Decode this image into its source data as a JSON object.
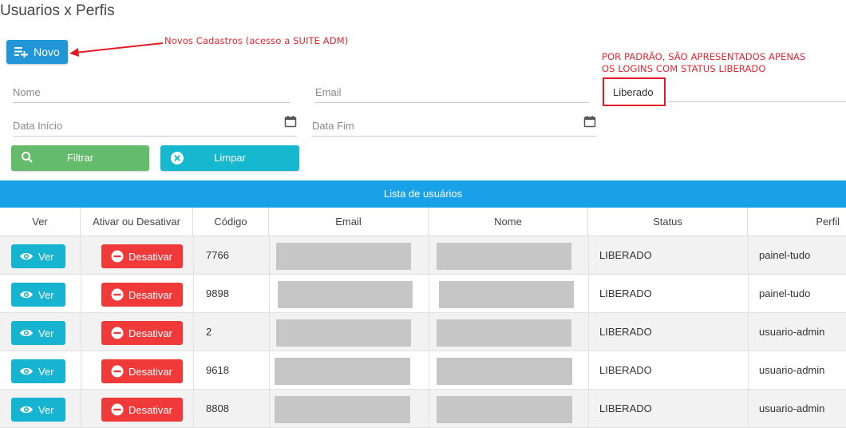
{
  "page": {
    "title": "Usuarios x Perfis"
  },
  "toolbar": {
    "novo_label": "Novo"
  },
  "annotations": {
    "novo_note": "Novos Cadastros (acesso a SUITE ADM)",
    "status_note_line1": "POR PADRÃO, SÃO APRESENTADOS APENAS",
    "status_note_line2": "OS LOGINS COM STATUS LIBERADO",
    "color": "#e8262f"
  },
  "filters": {
    "nome_placeholder": "Nome",
    "email_placeholder": "Email",
    "status_value": "Liberado",
    "data_inicio_placeholder": "Data Início",
    "data_fim_placeholder": "Data Fim",
    "filtrar_label": "Filtrar",
    "limpar_label": "Limpar"
  },
  "table": {
    "title": "Lista de usuários",
    "headers": [
      "Ver",
      "Ativar ou Desativar",
      "Código",
      "Email",
      "Nome",
      "Status",
      "Perfil"
    ],
    "ver_label": "Ver",
    "desativar_label": "Desativar",
    "rows": [
      {
        "codigo": "7766",
        "status": "LIBERADO",
        "perfil": "painel-tudo"
      },
      {
        "codigo": "9898",
        "status": "LIBERADO",
        "perfil": "painel-tudo"
      },
      {
        "codigo": "2",
        "status": "LIBERADO",
        "perfil": "usuario-admin"
      },
      {
        "codigo": "9618",
        "status": "LIBERADO",
        "perfil": "usuario-admin"
      },
      {
        "codigo": "8808",
        "status": "LIBERADO",
        "perfil": "usuario-admin"
      }
    ]
  },
  "colors": {
    "primary": "#2296d6",
    "banner": "#18a1e7",
    "filtrar": "#63bb6b",
    "limpar": "#15b8cf",
    "ver": "#17b4d2",
    "desativar": "#f03a3a",
    "redacted": "#c6c6c6"
  },
  "icons": {
    "novo": "playlist-add-icon",
    "calendar": "calendar-icon",
    "filtrar": "search-icon",
    "limpar": "close-circle-icon",
    "ver": "eye-icon",
    "desativar": "minus-circle-icon"
  }
}
